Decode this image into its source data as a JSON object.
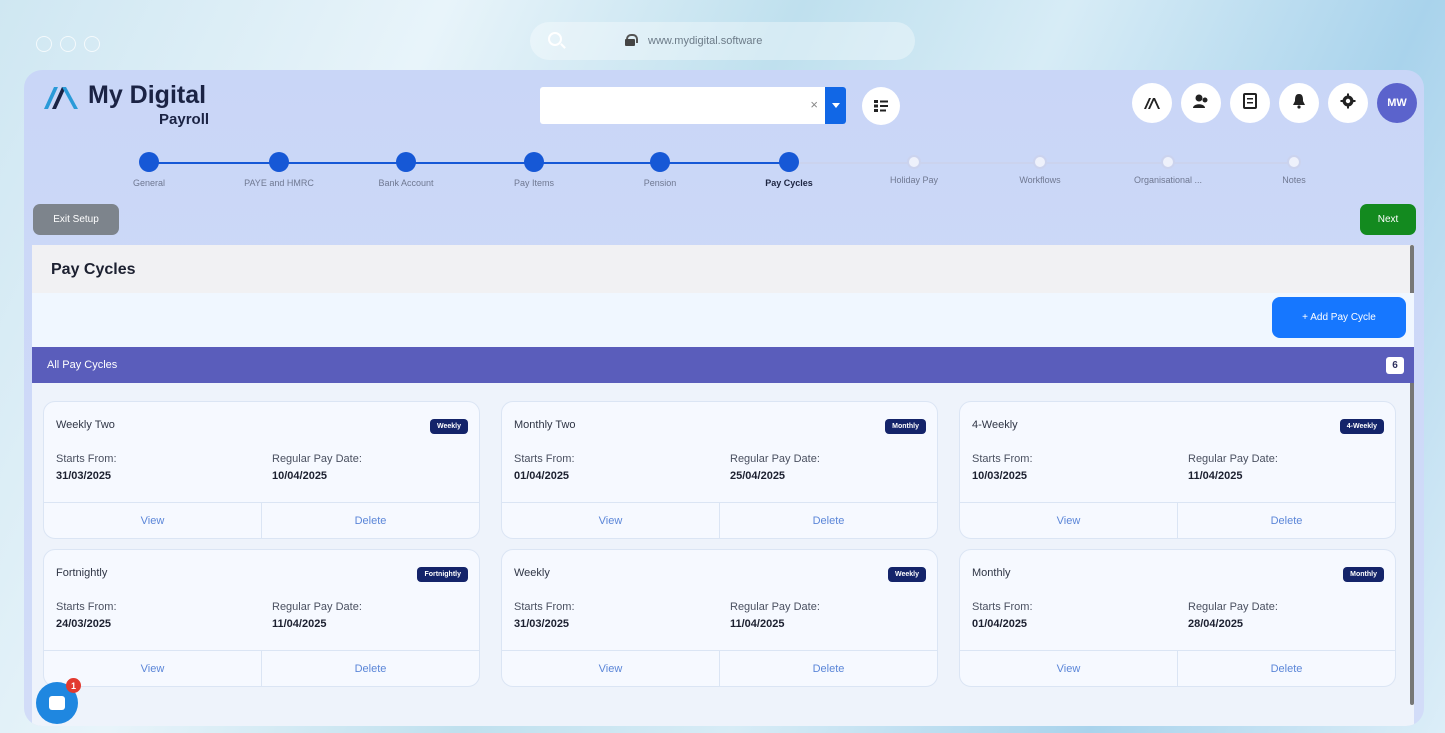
{
  "browser": {
    "url": "www.mydigital.software"
  },
  "app": {
    "brand_name": "My Digital",
    "brand_sub": "Payroll",
    "colors": {
      "primary": "#1658d6",
      "accent_bar": "#5a5dbb",
      "next_green": "#138a1f",
      "badge_navy": "#14246a"
    }
  },
  "header": {
    "company_select_value": "",
    "clear_icon": "×",
    "icons": [
      {
        "name": "brand-icon",
        "glyph": "⩕"
      },
      {
        "name": "users-icon",
        "glyph": "👥"
      },
      {
        "name": "document-icon",
        "glyph": "▤"
      },
      {
        "name": "bell-icon",
        "glyph": "🔔"
      },
      {
        "name": "gear-icon",
        "glyph": "⚙"
      }
    ],
    "avatar_initials": "MW"
  },
  "stepper": {
    "steps": [
      {
        "label": "General",
        "state": "done"
      },
      {
        "label": "PAYE and HMRC",
        "state": "done"
      },
      {
        "label": "Bank Account",
        "state": "done"
      },
      {
        "label": "Pay Items",
        "state": "done"
      },
      {
        "label": "Pension",
        "state": "done"
      },
      {
        "label": "Pay Cycles",
        "state": "active"
      },
      {
        "label": "Holiday Pay",
        "state": "todo"
      },
      {
        "label": "Workflows",
        "state": "todo"
      },
      {
        "label": "Organisational ...",
        "state": "todo"
      },
      {
        "label": "Notes",
        "state": "todo"
      }
    ],
    "exit_label": "Exit Setup",
    "next_label": "Next"
  },
  "page": {
    "title": "Pay Cycles",
    "add_button": "+ Add Pay Cycle",
    "list_title": "All Pay Cycles",
    "count": "6",
    "starts_label": "Starts From:",
    "regular_label": "Regular Pay Date:",
    "view_label": "View",
    "delete_label": "Delete"
  },
  "pay_cycles": [
    {
      "name": "Weekly Two",
      "frequency": "Weekly",
      "starts_from": "31/03/2025",
      "regular_pay_date": "10/04/2025"
    },
    {
      "name": "Monthly Two",
      "frequency": "Monthly",
      "starts_from": "01/04/2025",
      "regular_pay_date": "25/04/2025"
    },
    {
      "name": "4-Weekly",
      "frequency": "4-Weekly",
      "starts_from": "10/03/2025",
      "regular_pay_date": "11/04/2025"
    },
    {
      "name": "Fortnightly",
      "frequency": "Fortnightly",
      "starts_from": "24/03/2025",
      "regular_pay_date": "11/04/2025"
    },
    {
      "name": "Weekly",
      "frequency": "Weekly",
      "starts_from": "31/03/2025",
      "regular_pay_date": "11/04/2025"
    },
    {
      "name": "Monthly",
      "frequency": "Monthly",
      "starts_from": "01/04/2025",
      "regular_pay_date": "28/04/2025"
    }
  ],
  "chat": {
    "unread_count": "1"
  }
}
